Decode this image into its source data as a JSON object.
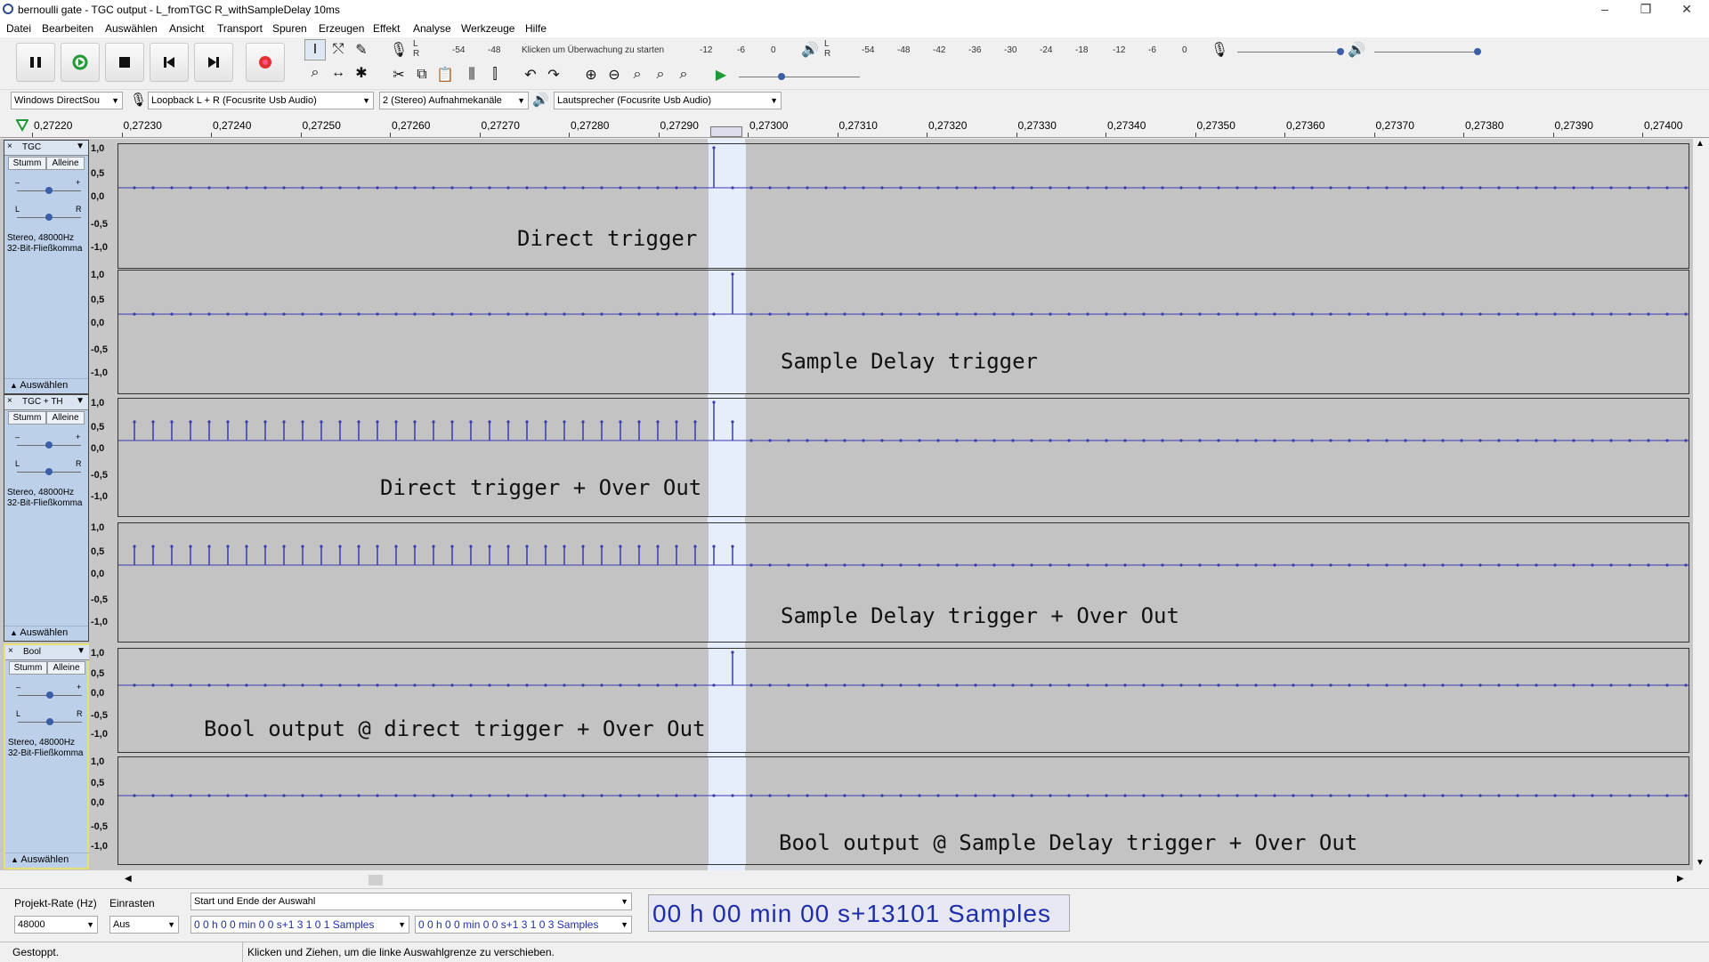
{
  "window": {
    "title": "bernoulli gate - TGC output - L_fromTGC R_withSampleDelay 10ms"
  },
  "menu": [
    "Datei",
    "Bearbeiten",
    "Auswählen",
    "Ansicht",
    "Transport",
    "Spuren",
    "Erzeugen",
    "Effekt",
    "Analyse",
    "Werkzeuge",
    "Hilfe"
  ],
  "meters": {
    "rec_ticks": [
      "-54",
      "-48",
      "-12",
      "-6",
      "0"
    ],
    "rec_prompt": "Klicken um Überwachung zu starten",
    "play_ticks": [
      "-54",
      "-48",
      "-42",
      "-36",
      "-30",
      "-24",
      "-18",
      "-12",
      "-6",
      "0"
    ],
    "lr": [
      "L",
      "R"
    ]
  },
  "devices": {
    "host": "Windows DirectSou",
    "input": "Loopback L + R (Focusrite Usb Audio)",
    "channels": "2 (Stereo) Aufnahmekanäle",
    "output": "Lautsprecher (Focusrite Usb Audio)"
  },
  "ruler": {
    "ticks": [
      "0,27220",
      "0,27230",
      "0,27240",
      "0,27250",
      "0,27260",
      "0,27270",
      "0,27280",
      "0,27290",
      "0,27300",
      "0,27310",
      "0,27320",
      "0,27330",
      "0,27340",
      "0,27350",
      "0,27360",
      "0,27370",
      "0,27380",
      "0,27390",
      "0,27400"
    ]
  },
  "scale": [
    "1,0",
    "0,5",
    "0,0",
    "-0,5",
    "-1,0"
  ],
  "common": {
    "mute": "Stumm",
    "solo": "Alleine",
    "select": "Auswählen",
    "info1": "Stereo, 48000Hz",
    "info2": "32-Bit-Fließkomma",
    "close": "×",
    "L": "L",
    "R": "R"
  },
  "tracks": [
    {
      "name": "TGC",
      "ch1_label": "Direct trigger",
      "ch2_label": "Sample Delay trigger"
    },
    {
      "name": "TGC + TH",
      "ch1_label": "Direct trigger + Over Out",
      "ch2_label": "Sample Delay trigger + Over Out"
    },
    {
      "name": "Bool",
      "ch1_label": "Bool output @ direct trigger + Over Out",
      "ch2_label": "Bool output @ Sample Delay trigger + Over Out"
    }
  ],
  "bottom": {
    "rate_label": "Projekt-Rate (Hz)",
    "rate_value": "48000",
    "snap_label": "Einrasten",
    "snap_value": "Aus",
    "selection_mode": "Start und Ende der Auswahl",
    "sel_start": "0 0 h 0 0 min 0 0 s+1 3 1 0 1 Samples",
    "sel_end": "0 0 h 0 0 min 0 0 s+1 3 1 0 3 Samples",
    "position": "00 h 00 min 00 s+13101 Samples"
  },
  "status": {
    "left": "Gestoppt.",
    "hint": "Klicken und Ziehen, um die linke Auswahlgrenze zu verschieben."
  }
}
